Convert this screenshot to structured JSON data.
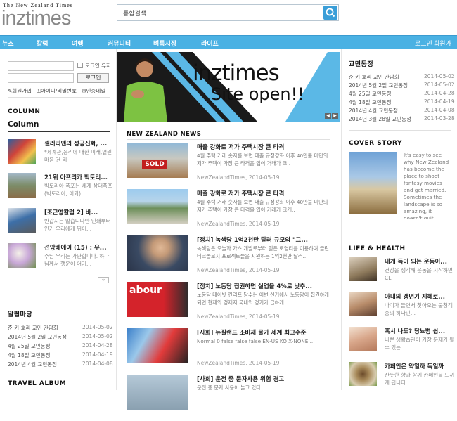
{
  "header": {
    "tagline": "The New Zealand Times",
    "logo": "inztimes",
    "search_select": "통합검색"
  },
  "nav": {
    "items": [
      "뉴스",
      "칼럼",
      "여행",
      "커뮤니티",
      "벼룩시장",
      "라이프"
    ],
    "right": [
      "로그인",
      "회원가입"
    ]
  },
  "login": {
    "keep": "로그인 유지",
    "button": "로그인",
    "links": [
      "회원가입",
      "아이디/비밀번호",
      "인증메일"
    ]
  },
  "column": {
    "section": "COLUMN",
    "heading": "Column",
    "items": [
      {
        "title": "셀러리맨의 성공신화, ...",
        "desc": "*세계관,윤리에 대한 미래,열린 마음 건 리"
      },
      {
        "title": "21위 아프리카 빅토리...",
        "desc": "빅토리아 폭포는 세계 삼대폭포 (빅토리아, 이과)..."
      },
      {
        "title": "[조근영칼럼 2] 바...",
        "desc": "반갑지는 않습니다만 인쇄부터 인기 우리에게 뛰어..."
      },
      {
        "title": "선앙베에이 (15) : 우...",
        "desc": "주님 우리는 가난합니다. 하나님께서 행운이 어기..."
      }
    ]
  },
  "notice_left": {
    "title": "알림마당",
    "items": [
      {
        "text": "준 키 호리 교민 간담회",
        "date": "2014-05-02"
      },
      {
        "text": "2014년 5월 2일 교민동정",
        "date": "2014-05-02"
      },
      {
        "text": "4월 25일 교민동정",
        "date": "2014-04-28"
      },
      {
        "text": "4월 18일 교민동정",
        "date": "2014-04-19"
      },
      {
        "text": "2014년 4월 교민동정",
        "date": "2014-04-08"
      }
    ]
  },
  "travel": {
    "title": "TRAVEL ALBUM"
  },
  "hero": {
    "brand": "inztimes",
    "line2": "Site open!!"
  },
  "news": {
    "section": "NEW ZEALAND NEWS",
    "items": [
      {
        "title": "매출 강화로 저가 주택시장 큰 타격",
        "desc": "4월 주택 거래 숫자를 보면 대출 규정강화 이후 40만불 미만의 저가 주택이 가장 큰 타격을 입어 거래가 크..",
        "meta": "NewZealandTimes,  2014-05-19"
      },
      {
        "title": "매출 강화로 저가 주택시장 큰 타격",
        "desc": "4월 주택 거래 숫자를 보면 대출 규정강화 이후 40만불 미만의 저가 주택이 가장 큰 타격을 입어 거래가 크게..",
        "meta": "NewZealandTimes,  2014-05-19"
      },
      {
        "title": "[정치] 녹색당 1억2천만 달러 규모의 \"그...",
        "desc": "녹색당은 오늘과 가스 개발로부터 얻은 로열티를 이용하여 클린 테크놀로지 프로젝트들을 지원하는 1억2천만 달러..",
        "meta": "NewZealandTimes,  2014-05-19"
      },
      {
        "title": "[정치] 노동당 집권하면 실업을 4%로 낮추...",
        "desc": "노동당 데이빗 컨리프 당수는 이번 선거에서 노동당이 집권하게 되면 현재의 경제지 국내의 경기가 급하게..",
        "meta": "NewZealandTimes,  2014-05-19"
      },
      {
        "title": "[사회] 뉴질랜드 소비재 물가 세계 최고수준",
        "desc": "Normal 0 false false false EN-US KO X-NONE ..",
        "meta": "NewZealandTimes,  2014-05-19"
      },
      {
        "title": "[사회] 운전 중 문자사용 위험 경고",
        "desc": "운전 중 문자 사용이 늘고 있다..",
        "meta": ""
      }
    ]
  },
  "notice_right": {
    "title": "교민동정",
    "items": [
      {
        "text": "준 키 호리 교민 간담회",
        "date": "2014-05-02"
      },
      {
        "text": "2014년 5월 2일 교민동정",
        "date": "2014-05-02"
      },
      {
        "text": "4월 25일 교민동정",
        "date": "2014-04-28"
      },
      {
        "text": "4월 18일 교민동정",
        "date": "2014-04-19"
      },
      {
        "text": "2014년 4월 교민동정",
        "date": "2014-04-08"
      },
      {
        "text": "2014년 3월 28일 교민동정",
        "date": "2014-03-28"
      }
    ]
  },
  "cover": {
    "title": "COVER STORY",
    "text": "It's easy to see why New Zealand has become the place to shoot fantasy movies and get married. Sometimes the landscape is so amazing, it doesn't quit."
  },
  "life": {
    "title": "LIFE & HEALTH",
    "items": [
      {
        "title": "내게 독이 되는 운동이...",
        "desc": "건강을 생각해 운동을 시작하면 CL"
      },
      {
        "title": "아내의 갱년기 지혜로...",
        "desc": "나이가 들면서 찾아오는 불청객 중의 하나인..."
      },
      {
        "title": "혹시 나도? 당뇨병 쉽...",
        "desc": "나쁜 생활습관이 가장 문제가 될 수 있는..."
      },
      {
        "title": "카페인은 약일까 독일까",
        "desc": "산뜻한 향과 함께 카페인을 느끼게 됩니다 ..."
      }
    ]
  }
}
